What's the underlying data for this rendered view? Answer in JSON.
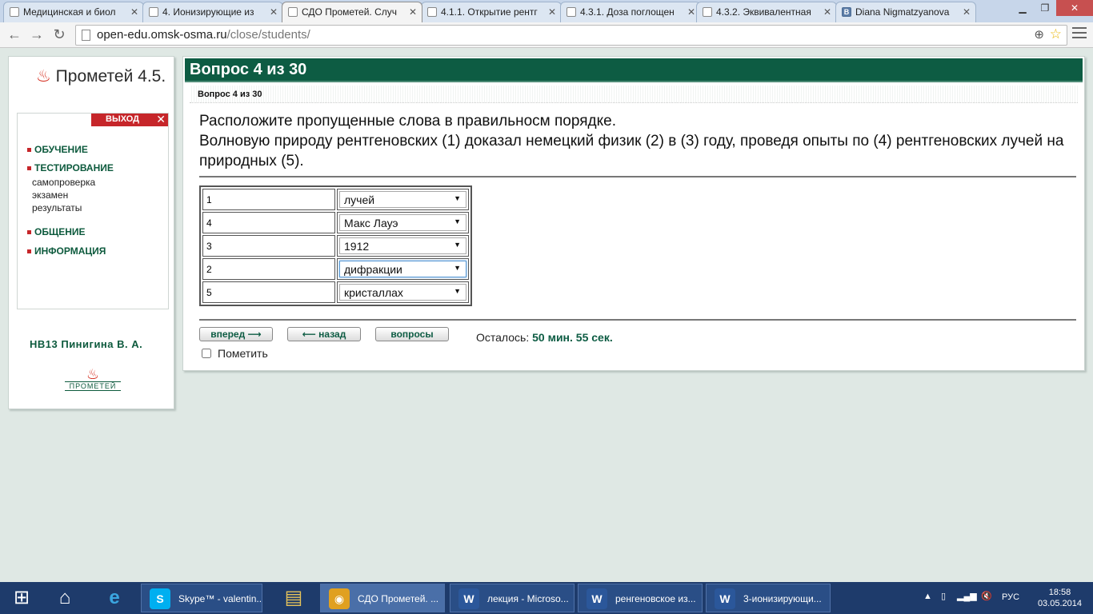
{
  "browser": {
    "tabs": [
      {
        "title": "Медицинская и биол",
        "icon": "page-icon"
      },
      {
        "title": "4. Ионизирующие из",
        "icon": "page-icon"
      },
      {
        "title": "СДО Прометей. Случ",
        "icon": "page-icon",
        "active": true
      },
      {
        "title": "4.1.1. Открытие рентг",
        "icon": "page-icon"
      },
      {
        "title": "4.3.1. Доза поглощен",
        "icon": "page-icon"
      },
      {
        "title": "4.3.2. Эквивалентная",
        "icon": "page-icon"
      },
      {
        "title": "Diana Nigmatzyanova",
        "icon": "vk-icon",
        "icon_letter": "B"
      }
    ],
    "url_host": "open-edu.omsk-osma.ru",
    "url_path": "/close/students/"
  },
  "sidebar": {
    "logo": "Прометей 4.5.",
    "exit_label": "ВЫХОД",
    "menu": [
      {
        "label": "ОБУЧЕНИЕ"
      },
      {
        "label": "ТЕСТИРОВАНИЕ"
      },
      {
        "label": "ОБЩЕНИЕ"
      },
      {
        "label": "ИНФОРМАЦИЯ"
      }
    ],
    "submenu": [
      "самопроверка",
      "экзамен",
      "результаты"
    ],
    "user": "НВ13 Пинигина В. А.",
    "small_logo": "ПРОМЕТЕЙ"
  },
  "main": {
    "header": "Вопрос 4 из 30",
    "subheader": "Вопрос 4 из 30",
    "question_line1": "Расположите пропущенные слова в правильносм порядке.",
    "question_line2": "Волновую природу рентгеновских (1) доказал немецкий физик (2) в (3) году, проведя опыты по (4) рентгеновских лучей на природных (5).",
    "rows": [
      {
        "num": "1",
        "value": "лучей"
      },
      {
        "num": "4",
        "value": "Макс Лауэ"
      },
      {
        "num": "3",
        "value": "1912"
      },
      {
        "num": "2",
        "value": "дифракции"
      },
      {
        "num": "5",
        "value": "кристаллах"
      }
    ],
    "buttons": {
      "forward": "вперед ⟶",
      "back": "⟵ назад",
      "questions": "вопросы"
    },
    "remaining_label": "Осталось:",
    "remaining_value": "50 мин. 55 сек.",
    "mark_label": "Пометить"
  },
  "taskbar": {
    "tasks": [
      {
        "label": "Skype™ - valentin...",
        "color": "#00aff0",
        "icon": "S"
      },
      {
        "label": "СДО Прометей. ...",
        "color": "#e0a020",
        "icon": "◉",
        "active": true
      },
      {
        "label": "лекция - Microso...",
        "color": "#2b579a",
        "icon": "W"
      },
      {
        "label": "ренгеновское из...",
        "color": "#2b579a",
        "icon": "W"
      },
      {
        "label": "3-ионизирующи...",
        "color": "#2b579a",
        "icon": "W"
      }
    ],
    "lang": "РУС",
    "time": "18:58",
    "date": "03.05.2014"
  }
}
